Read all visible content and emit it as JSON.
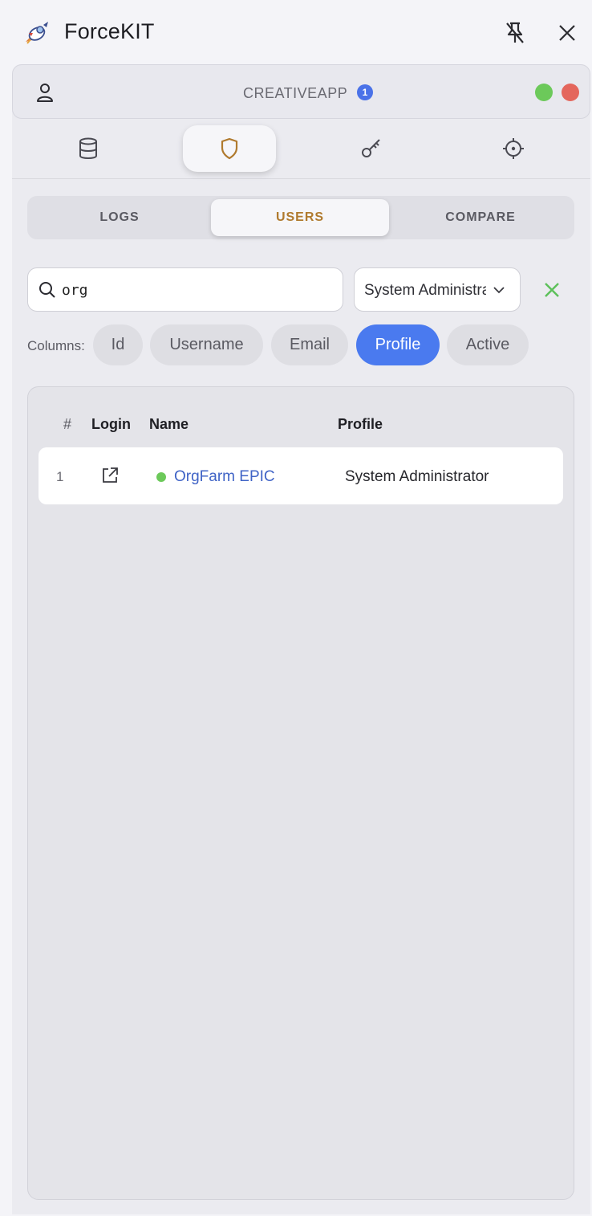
{
  "app": {
    "title": "ForceKIT",
    "icons": {
      "logo": "rocket-astronaut-logo",
      "unpin": "unpin-icon",
      "close": "close-icon"
    }
  },
  "org": {
    "name": "CREATIVEAPP",
    "badge_count": "1",
    "status_colors": {
      "green": "#6cc95a",
      "red": "#e4665c"
    }
  },
  "nav": {
    "tabs": [
      {
        "icon": "database-icon",
        "active": false
      },
      {
        "icon": "shield-icon",
        "active": true
      },
      {
        "icon": "key-icon",
        "active": false
      },
      {
        "icon": "target-icon",
        "active": false
      }
    ]
  },
  "subtabs": {
    "logs": "LOGS",
    "users": "USERS",
    "compare": "COMPARE",
    "active": "USERS"
  },
  "filters": {
    "search_value": "org",
    "profile_select": "System Administrator",
    "clear_icon": "clear-x-icon"
  },
  "columns": {
    "label": "Columns:",
    "chips": [
      {
        "label": "Id",
        "active": false
      },
      {
        "label": "Username",
        "active": false
      },
      {
        "label": "Email",
        "active": false
      },
      {
        "label": "Profile",
        "active": true
      },
      {
        "label": "Active",
        "active": false
      }
    ]
  },
  "table": {
    "headers": {
      "num": "#",
      "login": "Login",
      "name": "Name",
      "profile": "Profile"
    },
    "rows": [
      {
        "num": "1",
        "name": "OrgFarm EPIC",
        "profile": "System Administrator",
        "active": true
      }
    ]
  },
  "colors": {
    "accent": "#4a7aef",
    "active_tab": "#b07a2e",
    "link": "#3f63c6"
  }
}
